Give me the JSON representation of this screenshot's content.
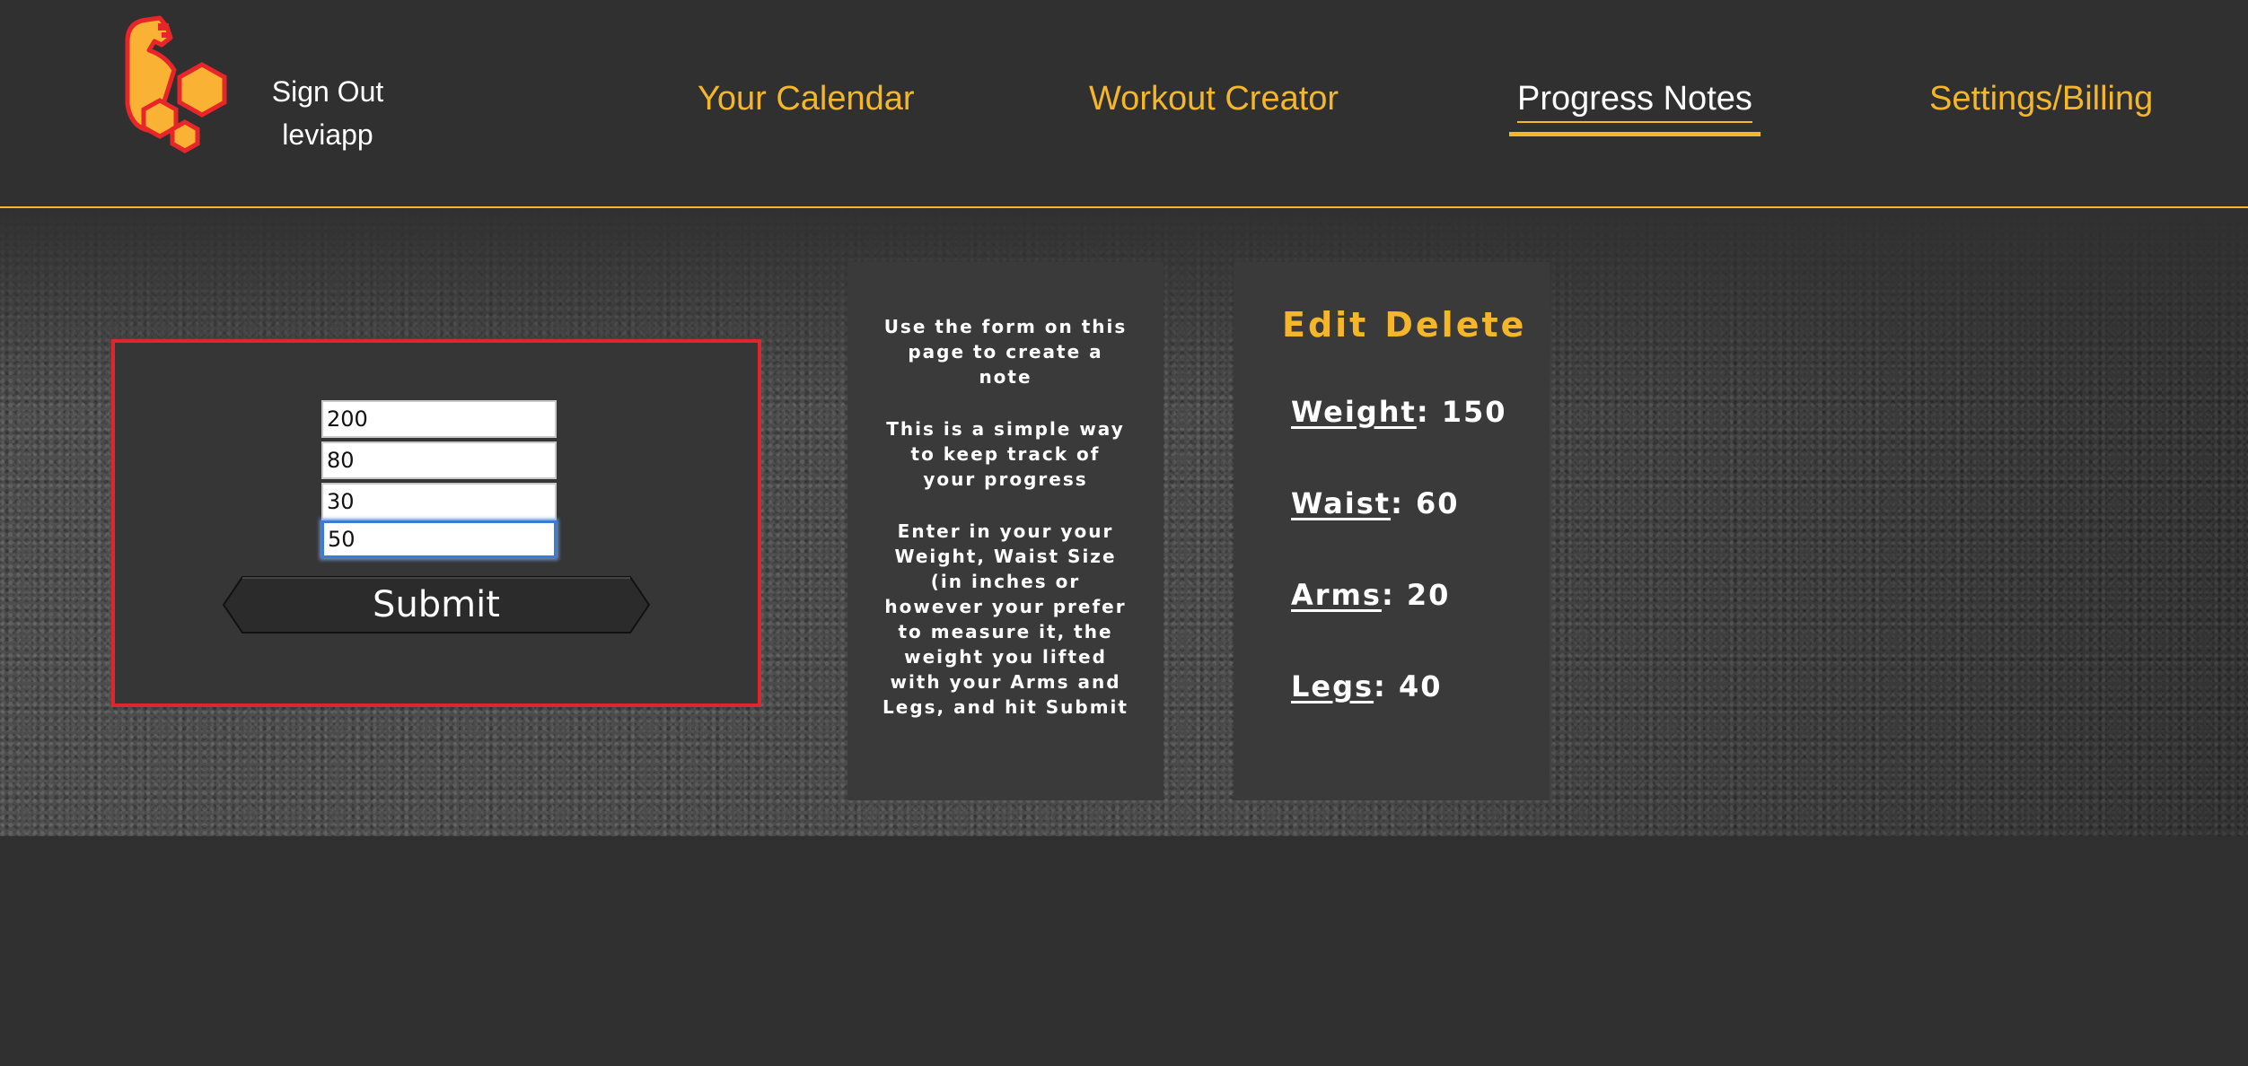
{
  "header": {
    "logo": "flexed-arm-hexagon-logo",
    "account": {
      "sign_out_label": "Sign Out",
      "username": "leviapp"
    },
    "nav": [
      {
        "label": "Your Calendar",
        "active": false
      },
      {
        "label": "Workout Creator",
        "active": false
      },
      {
        "label": "Progress Notes",
        "active": true
      },
      {
        "label": "Settings/Billing",
        "active": false
      }
    ]
  },
  "form": {
    "fields": [
      {
        "name": "weight",
        "value": "200"
      },
      {
        "name": "waist",
        "value": "80"
      },
      {
        "name": "arms",
        "value": "30"
      },
      {
        "name": "legs",
        "value": "50",
        "focused": true
      }
    ],
    "submit_label": "Submit"
  },
  "instructions": {
    "paragraphs": [
      "Use the form on this page to create a note",
      "This is a simple way to keep track of your progress",
      "Enter in your your Weight, Waist Size (in inches or however your prefer to measure it, the weight you lifted with your Arms and Legs, and hit Submit"
    ]
  },
  "note": {
    "edit_label": "Edit",
    "delete_label": "Delete",
    "stats": [
      {
        "label": "Weight",
        "value": ": 150"
      },
      {
        "label": "Waist",
        "value": ": 60"
      },
      {
        "label": "Arms",
        "value": ": 20"
      },
      {
        "label": "Legs",
        "value": ": 40"
      }
    ]
  },
  "colors": {
    "accent": "#f5b729",
    "background": "#303030",
    "panel": "#3a3a3a",
    "form_border": "#e0262c",
    "logo_fill": "#f9b233",
    "logo_stroke": "#e8262a",
    "focus_ring": "#3b7bd8"
  }
}
